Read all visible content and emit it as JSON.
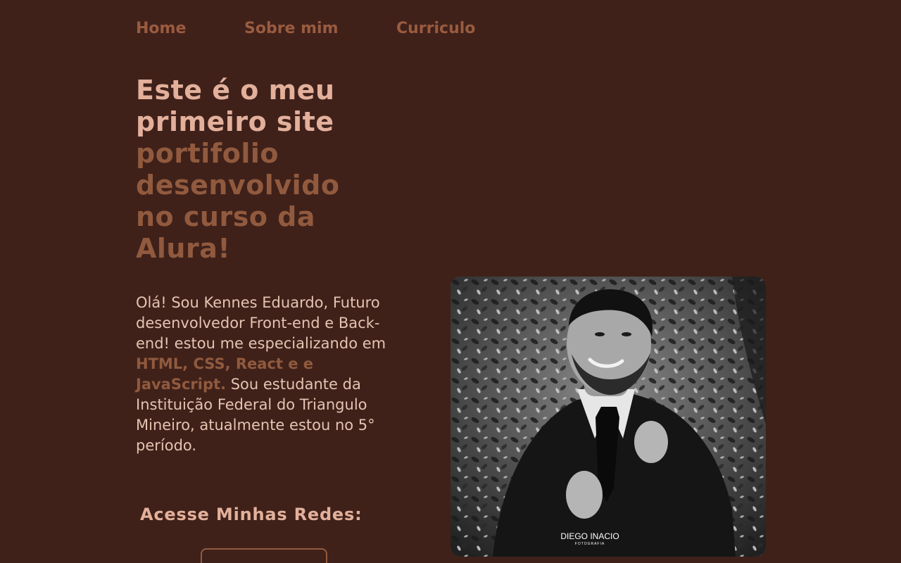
{
  "nav": {
    "home": "Home",
    "sobre": "Sobre mim",
    "curriculo": "Curriculo"
  },
  "headline": {
    "light_1": "Este é o meu",
    "light_2": "primeiro site",
    "dark_1": "portifolio",
    "dark_2": "desenvolvido",
    "dark_3": "no curso da",
    "dark_4": "Alura!"
  },
  "intro": {
    "part_1": "Olá! Sou Kennes Eduardo, Futuro desenvolvedor Front-end e Back-end! estou me especializando em ",
    "highlight": "HTML, CSS, React e e JavaScript.",
    "part_2": " Sou estudante da Instituição Federal do Triangulo Mineiro, atualmente estou no 5° período."
  },
  "redes": {
    "title": "Acesse Minhas Redes:"
  },
  "photo": {
    "watermark_name": "DIEGO INACIO",
    "watermark_sub": "FOTOGRAFIA"
  },
  "colors": {
    "background": "#3f211a",
    "accent_dark": "#915a3e",
    "accent_light": "#e3b09b",
    "body_text": "#e4c4b1"
  }
}
